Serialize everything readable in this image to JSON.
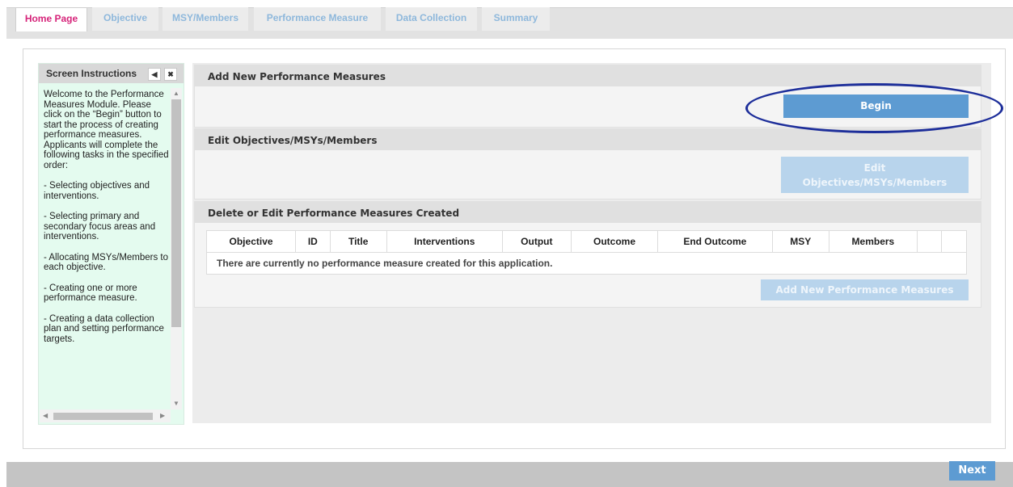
{
  "tabs": [
    {
      "label": "Home Page",
      "active": true
    },
    {
      "label": "Objective",
      "active": false
    },
    {
      "label": "MSY/Members",
      "active": false
    },
    {
      "label": "Performance Measure",
      "active": false
    },
    {
      "label": "Data Collection",
      "active": false
    },
    {
      "label": "Summary",
      "active": false
    }
  ],
  "instructions": {
    "title": "Screen Instructions",
    "collapse_icon": "◀",
    "close_icon": "✖",
    "paragraphs": [
      "Welcome to the Performance Measures Module. Please click on the “Begin” button to start the process of creating performance measures. Applicants will complete the following tasks in the specified order:",
      "- Selecting objectives and interventions.",
      "- Selecting primary and secondary focus areas and interventions.",
      "- Allocating MSYs/Members to each objective.",
      "- Creating one or more performance measure.",
      "- Creating a data collection plan and setting performance targets."
    ]
  },
  "sections": {
    "add_new": {
      "title": "Add New Performance Measures",
      "button": "Begin"
    },
    "edit": {
      "title": "Edit Objectives/MSYs/Members",
      "button_line1": "Edit",
      "button_line2": "Objectives/MSYs/Members"
    },
    "created": {
      "title": "Delete or Edit Performance Measures Created",
      "columns": [
        "Objective",
        "ID",
        "Title",
        "Interventions",
        "Output",
        "Outcome",
        "End Outcome",
        "MSY",
        "Members",
        "",
        ""
      ],
      "empty_message": "There are currently no performance measure created for this application.",
      "button": "Add New Performance Measures"
    }
  },
  "footer": {
    "next_label": "Next"
  },
  "colors": {
    "accent": "#5d9bd2",
    "active_tab": "#d6247a",
    "annotation": "#1d2e9a",
    "instructions_bg": "#e4fbef"
  }
}
